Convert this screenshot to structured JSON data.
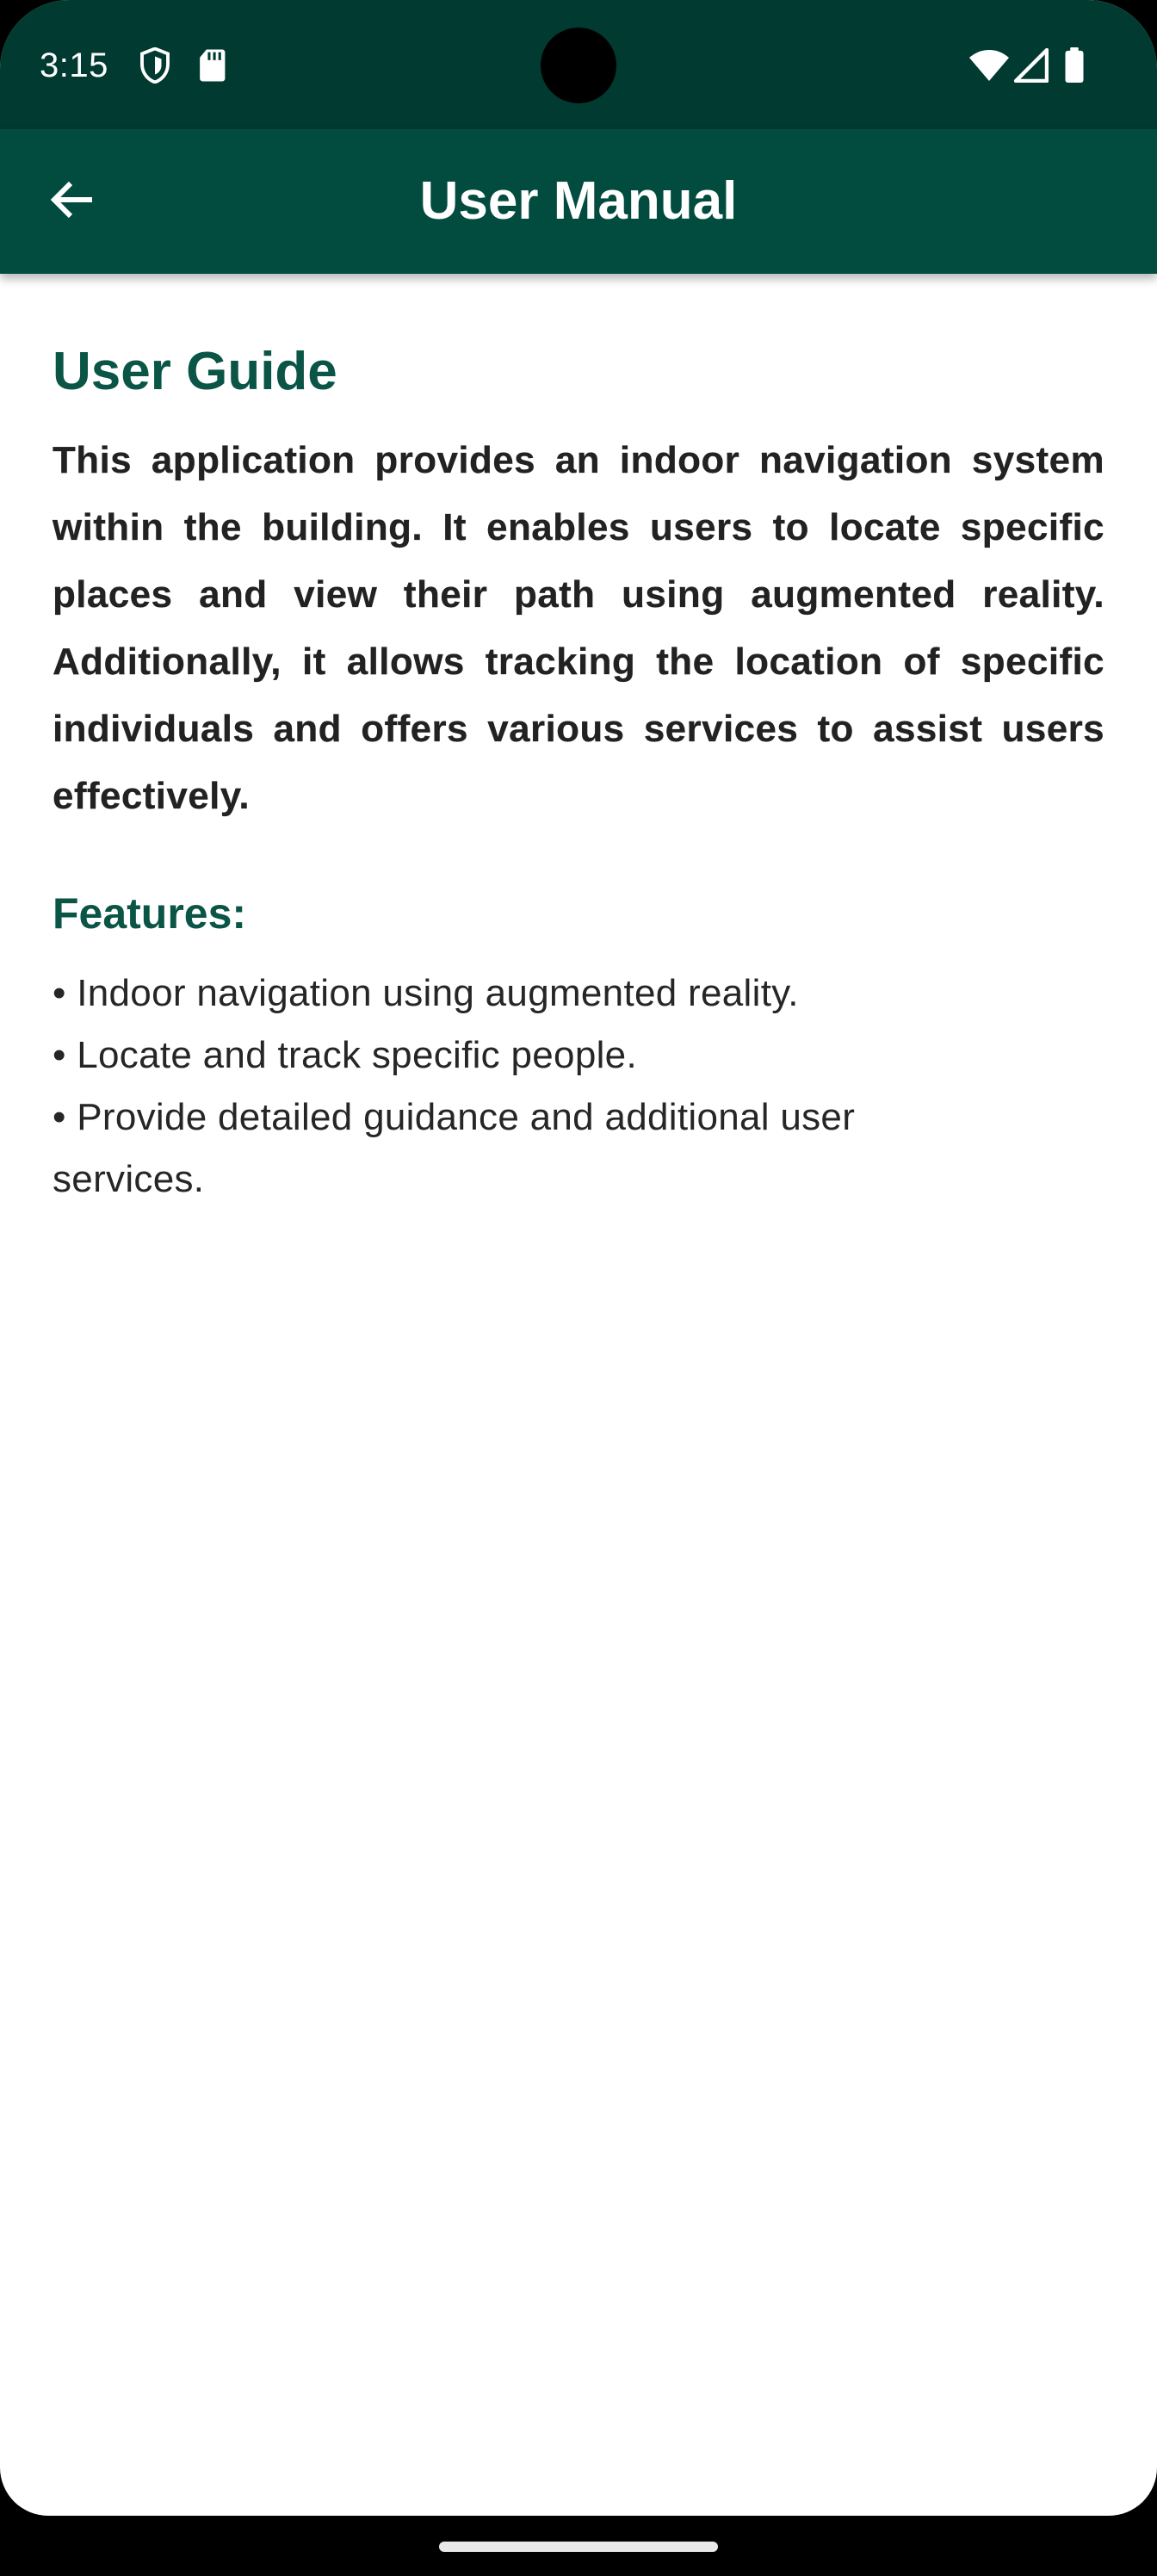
{
  "status_bar": {
    "time": "3:15",
    "icons_left": [
      "shield-icon",
      "sd-card-icon"
    ],
    "icons_right": [
      "wifi-icon",
      "cell-signal-icon",
      "battery-icon"
    ]
  },
  "app_bar": {
    "title": "User Manual",
    "back_icon": "arrow-back-icon"
  },
  "content": {
    "section_title": "User Guide",
    "intro": "This application provides an indoor navigation system within the building. It enables users to locate specific places and view their path using augmented reality. Additionally, it allows tracking the location of specific individuals and offers various services to assist users effectively.",
    "features_title": "Features:",
    "features": [
      "• Indoor navigation using augmented reality.",
      "• Locate and track specific people.",
      "• Provide detailed guidance and additional user services."
    ]
  },
  "colors": {
    "status_bar": "#013a31",
    "app_bar": "#024c3f",
    "heading": "#0b5547",
    "body_text": "#222222"
  }
}
